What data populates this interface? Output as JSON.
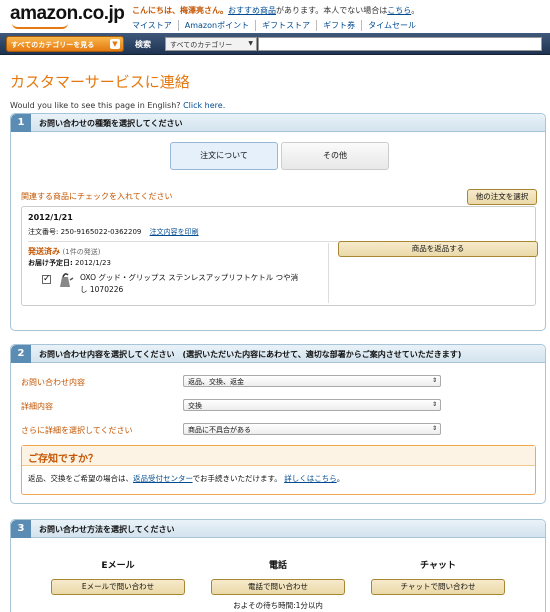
{
  "header": {
    "logo": "amazon.co.jp",
    "greeting_name": "こんにちは、梅澤亮さん。",
    "greeting_recommend": "おすすめ商品",
    "greeting_middle": "があります。本人でない場合は",
    "greeting_here": "こちら",
    "greeting_end": "。",
    "nav": [
      "マイストア",
      "Amazonポイント",
      "ギフトストア",
      "ギフト券",
      "タイムセール"
    ]
  },
  "navbar": {
    "category_button": "すべてのカテゴリーを見る",
    "search_label": "検索",
    "search_select": "すべてのカテゴリー"
  },
  "page": {
    "title": "カスタマーサービスに連絡",
    "english_prompt": "Would you like to see this page in English?",
    "english_link": "Click here."
  },
  "step1": {
    "number": "1",
    "title": "お問い合わせの種類を選択してください",
    "tabs": [
      "注文について",
      "その他"
    ],
    "check_prompt": "関連する商品にチェックを入れてください",
    "other_orders_button": "他の注文を選択",
    "order_date": "2012/1/21",
    "order_number_label": "注文番号: 250-9165022-0362209",
    "print_link": "注文内容を印刷",
    "shipped_label": "発送済み",
    "shipped_count": "(1件の発送)",
    "delivery_label": "お届け予定日:",
    "delivery_date": "2012/1/23",
    "product_name_line1": "OXO グッド・グリップス ステンレスアップリフトケトル つや消",
    "product_name_line2": "し 1070226",
    "return_button": "商品を返品する"
  },
  "step2": {
    "number": "2",
    "title": "お問い合わせ内容を選択してください　(選択いただいた内容にあわせて、適切な部署からご案内させていただきます)",
    "rows": [
      {
        "label": "お問い合わせ内容",
        "value": "返品、交換、返金"
      },
      {
        "label": "詳細内容",
        "value": "交換"
      },
      {
        "label": "さらに詳細を選択してください",
        "value": "商品に不具合がある"
      }
    ],
    "notice_title": "ご存知ですか？",
    "notice_pre": "返品、交換をご希望の場合は、",
    "notice_link1": "返品受付センター",
    "notice_mid": "でお手続きいただけます。",
    "notice_link2": "詳しくはこちら",
    "notice_end": "。"
  },
  "step3": {
    "number": "3",
    "title": "お問い合わせ方法を選択してください",
    "methods": [
      {
        "heading": "Eメール",
        "button": "Eメールで問い合わせ"
      },
      {
        "heading": "電話",
        "button": "電話で問い合わせ",
        "note": "およその待ち時間:1分以内"
      },
      {
        "heading": "チャット",
        "button": "チャットで問い合わせ"
      }
    ]
  },
  "colors": {
    "accent": "#e47911",
    "link": "#004b91",
    "navbar": "#2a4365",
    "alert": "#c45500"
  }
}
